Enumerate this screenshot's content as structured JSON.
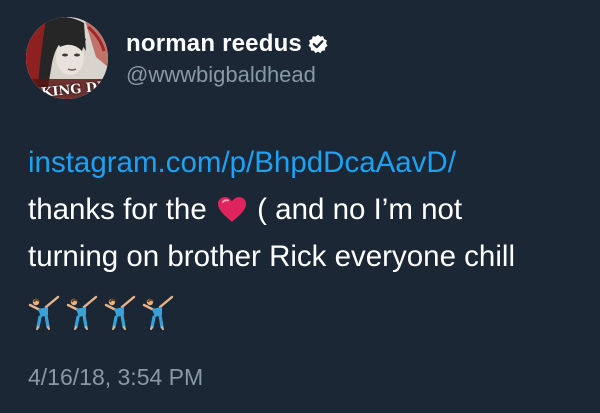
{
  "tweet": {
    "display_name": "norman reedus",
    "verified_icon": "verified-check-icon",
    "handle": "@wwwbigbaldhead",
    "avatar_text": "LKING DE",
    "link": "instagram.com/p/BhpdDcaAavD/",
    "line1_before": "thanks for the",
    "line1_after": "( and no I’m not",
    "line2": "turning on brother Rick everyone chill",
    "heart_icon": "red-heart-icon",
    "emojis": [
      "cartwheel-icon",
      "cartwheel-icon",
      "cartwheel-icon",
      "cartwheel-icon"
    ],
    "timestamp": "4/16/18, 3:54 PM"
  },
  "colors": {
    "background": "#1b2735",
    "link": "#1da1f2",
    "secondary_text": "#8899a6",
    "heart": "#e0245e"
  }
}
